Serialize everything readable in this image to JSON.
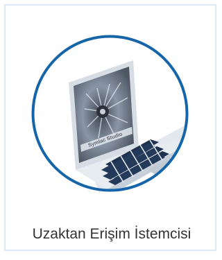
{
  "app_tile": {
    "label": "Uzaktan Erişim İstemcisi",
    "illustration_icon": "laptop-icon",
    "screen_caption": "Symlac Studio",
    "ring_color": "#1565a8"
  }
}
